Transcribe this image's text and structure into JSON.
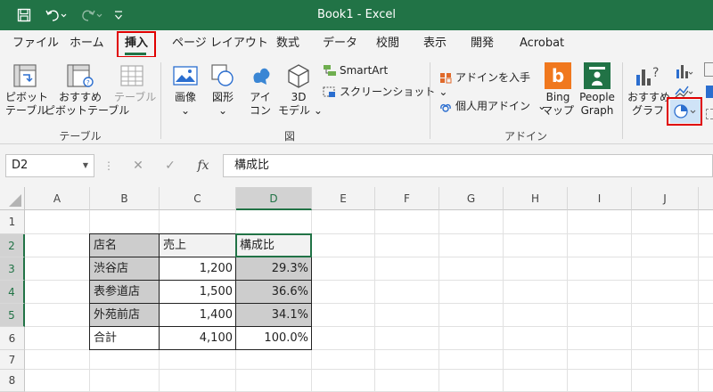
{
  "window": {
    "title": "Book1  -  Excel"
  },
  "quick_access": {
    "save_icon": "save-icon",
    "undo_icon": "undo-icon",
    "redo_icon": "redo-icon",
    "customize_icon": "customize-qat-icon"
  },
  "tabs": [
    {
      "label": "ファイル"
    },
    {
      "label": "ホーム"
    },
    {
      "label": "挿入"
    },
    {
      "label": "ページ レイアウト"
    },
    {
      "label": "数式"
    },
    {
      "label": "データ"
    },
    {
      "label": "校閲"
    },
    {
      "label": "表示"
    },
    {
      "label": "開発"
    },
    {
      "label": "Acrobat"
    }
  ],
  "active_tab": "挿入",
  "ribbon": {
    "table_group": {
      "label": "テーブル",
      "pivot": [
        "ピボット",
        "テーブル"
      ],
      "recommended_pivot": [
        "おすすめ",
        "ピボットテーブル"
      ],
      "table": "テーブル"
    },
    "illustrations_group": {
      "label": "図",
      "image": "画像",
      "shapes": "図形",
      "icons": [
        "アイ",
        "コン"
      ],
      "models3d": [
        "3D",
        "モデル"
      ],
      "smartart": "SmartArt",
      "screenshot": "スクリーンショット"
    },
    "addins_group": {
      "label": "アドイン",
      "get_addins": "アドインを入手",
      "my_addins": "個人用アドイン",
      "bing": [
        "Bing",
        "マップ"
      ],
      "people": [
        "People",
        "Graph"
      ]
    },
    "charts_group": {
      "recommended": [
        "おすすめ",
        "グラフ"
      ]
    }
  },
  "formula_bar": {
    "name_box": "D2",
    "cancel": "✕",
    "enter": "✓",
    "fx": "fx",
    "content": "構成比"
  },
  "grid": {
    "columns": [
      "A",
      "B",
      "C",
      "D",
      "E",
      "F",
      "G",
      "H",
      "I",
      "J"
    ],
    "rows": [
      "1",
      "2",
      "3",
      "4",
      "5",
      "6",
      "7",
      "8"
    ],
    "table": {
      "header": [
        "店名",
        "売上",
        "構成比"
      ],
      "rows": [
        [
          "渋谷店",
          "1,200",
          "29.3%"
        ],
        [
          "表参道店",
          "1,500",
          "36.6%"
        ],
        [
          "外苑前店",
          "1,400",
          "34.1%"
        ],
        [
          "合計",
          "4,100",
          "100.0%"
        ]
      ]
    }
  },
  "colors": {
    "excel_green": "#217346",
    "highlight_red": "#e00000",
    "selection_gray": "#cdcdcd"
  }
}
